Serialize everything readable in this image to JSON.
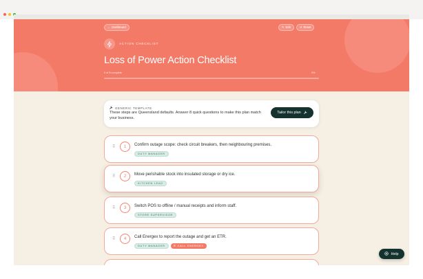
{
  "window": {
    "traffic_lights": [
      "#ff5f57",
      "#febc2e",
      "#28c840"
    ]
  },
  "header": {
    "back_label": "Dashboard",
    "edit_label": "Edit",
    "reset_label": "Reset",
    "eyebrow": "ACTION CHECKLIST",
    "title": "Loss of Power Action Checklist",
    "progress_text": "0 of 8 complete",
    "progress_percent_text": "0%",
    "progress_fraction": 0,
    "icon": "bolt-icon",
    "bg_color": "#f47a68"
  },
  "template_card": {
    "label": "GENERIC TEMPLATE",
    "body": "These steps are Queensland defaults. Answer 8 quick questions to make this plan match your business.",
    "button_label": "Tailor this plan",
    "icon": "wrench-icon"
  },
  "tasks": [
    {
      "number": "1",
      "text": "Confirm outage scope: check circuit breakers, then neighbouring premises.",
      "role": "DUTY MANAGER"
    },
    {
      "number": "2",
      "text": "Move perishable stock into insulated storage or dry ice.",
      "role": "KITCHEN LEAD"
    },
    {
      "number": "3",
      "text": "Switch POS to offline / manual receipts and inform staff.",
      "role": "STORE SUPERVISOR"
    },
    {
      "number": "4",
      "text": "Call Energex to report the outage and get an ETR.",
      "role": "DUTY MANAGER",
      "call_label": "CALL ENERGEX"
    }
  ],
  "help_label": "Help",
  "colors": {
    "accent": "#f47a68",
    "dark": "#15332e",
    "page_bg": "#f5efe4"
  }
}
